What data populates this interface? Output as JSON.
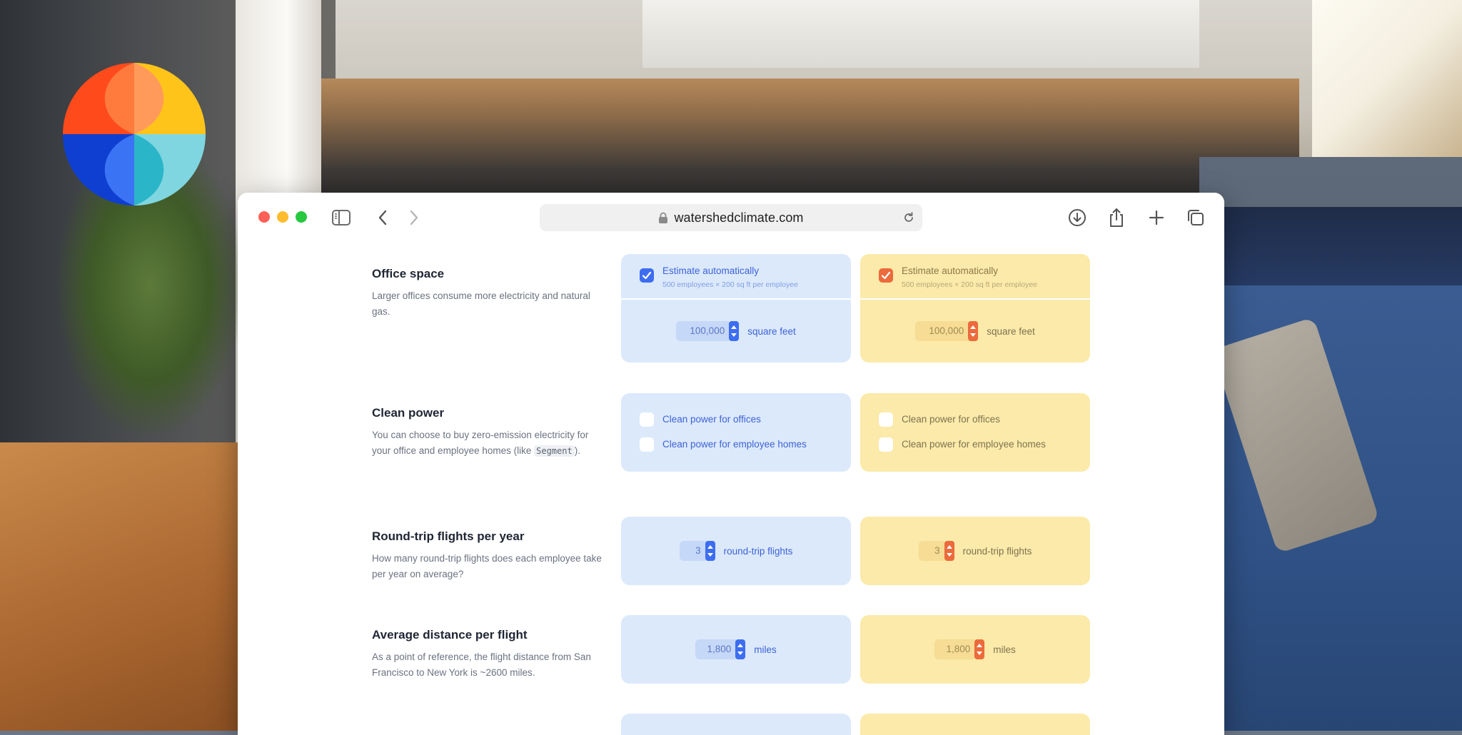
{
  "browser": {
    "url": "watershedclimate.com"
  },
  "rows": {
    "office": {
      "title": "Office space",
      "description": "Larger offices consume more electricity and natural gas.",
      "estimate_label": "Estimate automatically",
      "estimate_sub": "500 employees × 200 sq ft per employee",
      "value": "100,000",
      "unit": "square feet"
    },
    "clean_power": {
      "title": "Clean power",
      "description_before": "You can choose to buy zero-emission electricity for your office and employee homes (like ",
      "description_code": "Segment",
      "description_after": ").",
      "option_offices": "Clean power for offices",
      "option_homes": "Clean power for employee homes"
    },
    "flights": {
      "title": "Round-trip flights per year",
      "description": "How many round-trip flights does each employee take per year on average?",
      "value": "3",
      "unit": "round-trip flights"
    },
    "distance": {
      "title": "Average distance per flight",
      "description": "As a point of reference, the flight distance from San Francisco to New York is ~2600 miles.",
      "value": "1,800",
      "unit": "miles"
    }
  },
  "colors": {
    "blue_scenario": "#dce9fb",
    "yellow_scenario": "#fbeaa9",
    "blue_accent": "#3d6df0",
    "orange_accent": "#ec6a3c"
  }
}
